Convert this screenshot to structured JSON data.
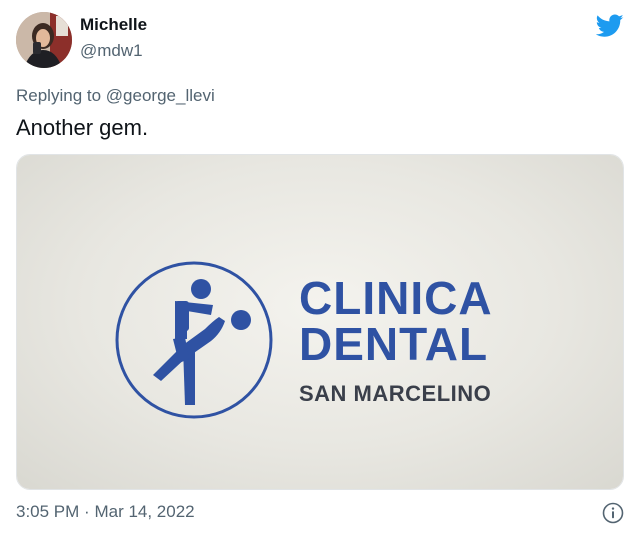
{
  "author": {
    "display_name": "Michelle",
    "handle": "@mdw1"
  },
  "reply": {
    "prefix": "Replying to",
    "mention": "@george_llevi"
  },
  "tweet": {
    "text": "Another gem.",
    "timestamp": "3:05 PM",
    "separator": "·",
    "date": "Mar 14, 2022"
  },
  "media": {
    "clinic_line1": "CLINICA",
    "clinic_line2": "DENTAL",
    "clinic_location": "SAN MARCELINO"
  },
  "icons": {
    "brand": "twitter-bird-icon",
    "info": "info-icon"
  },
  "colors": {
    "twitter_blue": "#1d9bf0",
    "logo_blue": "#2f52a3",
    "text_primary": "#0f1419",
    "text_secondary": "#536471"
  }
}
